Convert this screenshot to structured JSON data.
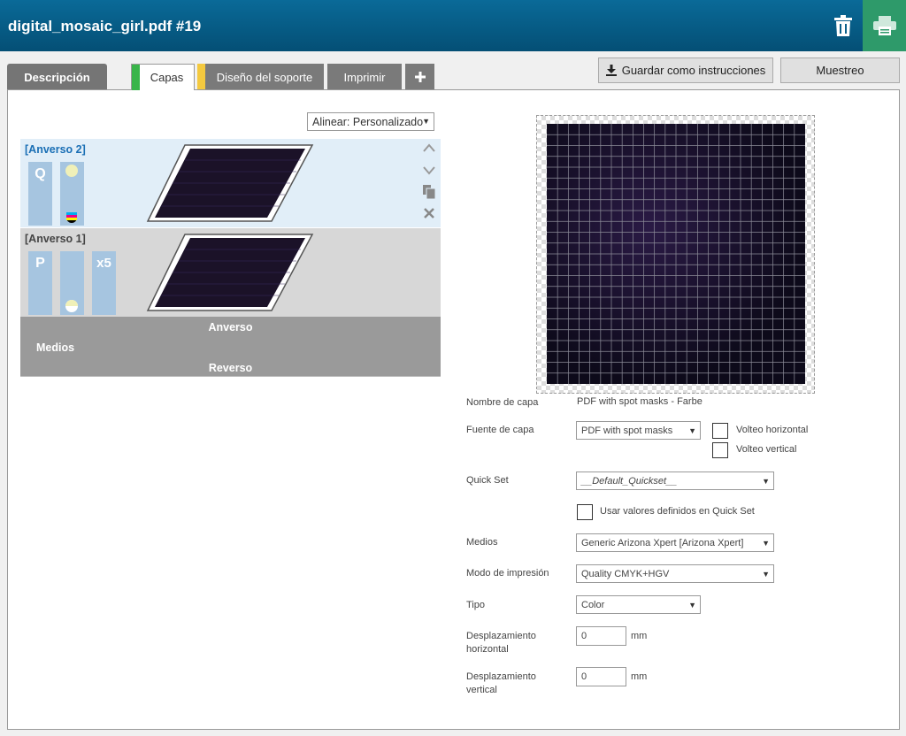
{
  "header": {
    "title": "digital_mosaic_girl.pdf #19"
  },
  "tabs": {
    "description": "Descripción",
    "layers": "Capas",
    "media_design": "Diseño del soporte",
    "print": "Imprimir",
    "add": "+"
  },
  "toolbar": {
    "save_instructions": "Guardar como instrucciones",
    "sampling": "Muestreo"
  },
  "align": {
    "value": "Alinear: Personalizado"
  },
  "layers": [
    {
      "title": "[Anverso 2]",
      "chip1": "Q",
      "chip2": "",
      "chip3": ""
    },
    {
      "title": "[Anverso 1]",
      "chip1": "P",
      "chip2": "",
      "chip3": "x5"
    }
  ],
  "media": {
    "front": "Anverso",
    "label": "Medios",
    "back": "Reverso"
  },
  "form": {
    "layer_name_label": "Nombre de capa",
    "layer_name_value": "PDF with spot masks - Farbe",
    "layer_source_label": "Fuente de capa",
    "layer_source_value": "PDF with spot masks",
    "flip_h": "Volteo horizontal",
    "flip_v": "Volteo vertical",
    "quickset_label": "Quick Set",
    "quickset_value": "__Default_Quickset__",
    "use_quickset": "Usar valores definidos en Quick Set",
    "media_label": "Medios",
    "media_value": "Generic Arizona Xpert [Arizona Xpert]",
    "print_mode_label": "Modo de impresión",
    "print_mode_value": "Quality CMYK+HGV",
    "type_label": "Tipo",
    "type_value": "Color",
    "offset_h_label_1": "Desplazamiento",
    "offset_h_label_2": "horizontal",
    "offset_h_value": "0",
    "offset_v_label_1": "Desplazamiento",
    "offset_v_label_2": "vertical",
    "offset_v_value": "0",
    "unit": "mm"
  },
  "colors": {
    "header": "#055a85",
    "print_button": "#2e9a6a",
    "layers_marker": "#39b54a",
    "media_marker": "#f4c93f"
  }
}
